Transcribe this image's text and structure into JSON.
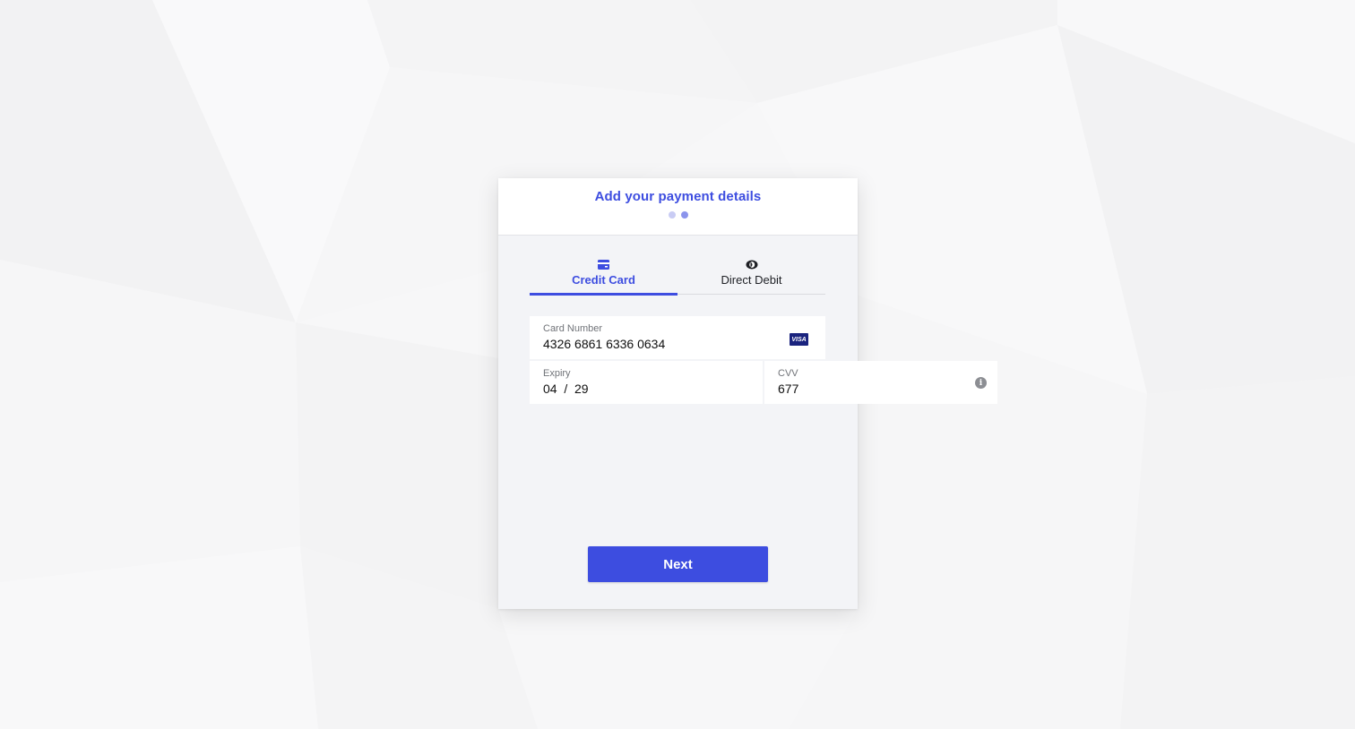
{
  "header": {
    "title": "Add your payment details",
    "steps": 2,
    "current_step": 2
  },
  "tabs": [
    {
      "label": "Credit Card",
      "icon": "credit-card-icon",
      "active": true
    },
    {
      "label": "Direct Debit",
      "icon": "direct-debit-icon",
      "active": false
    }
  ],
  "form": {
    "card_number": {
      "label": "Card Number",
      "value": "4326 6861 6336 0634",
      "brand": "VISA"
    },
    "expiry": {
      "label": "Expiry",
      "value": "04  /  29"
    },
    "cvv": {
      "label": "CVV",
      "value": "677",
      "info_icon": "info-icon"
    }
  },
  "next_button": {
    "label": "Next"
  },
  "colors": {
    "accent": "#3d4de0",
    "card_bg": "#f3f4f7",
    "page_bg": "#f7f7f8"
  }
}
